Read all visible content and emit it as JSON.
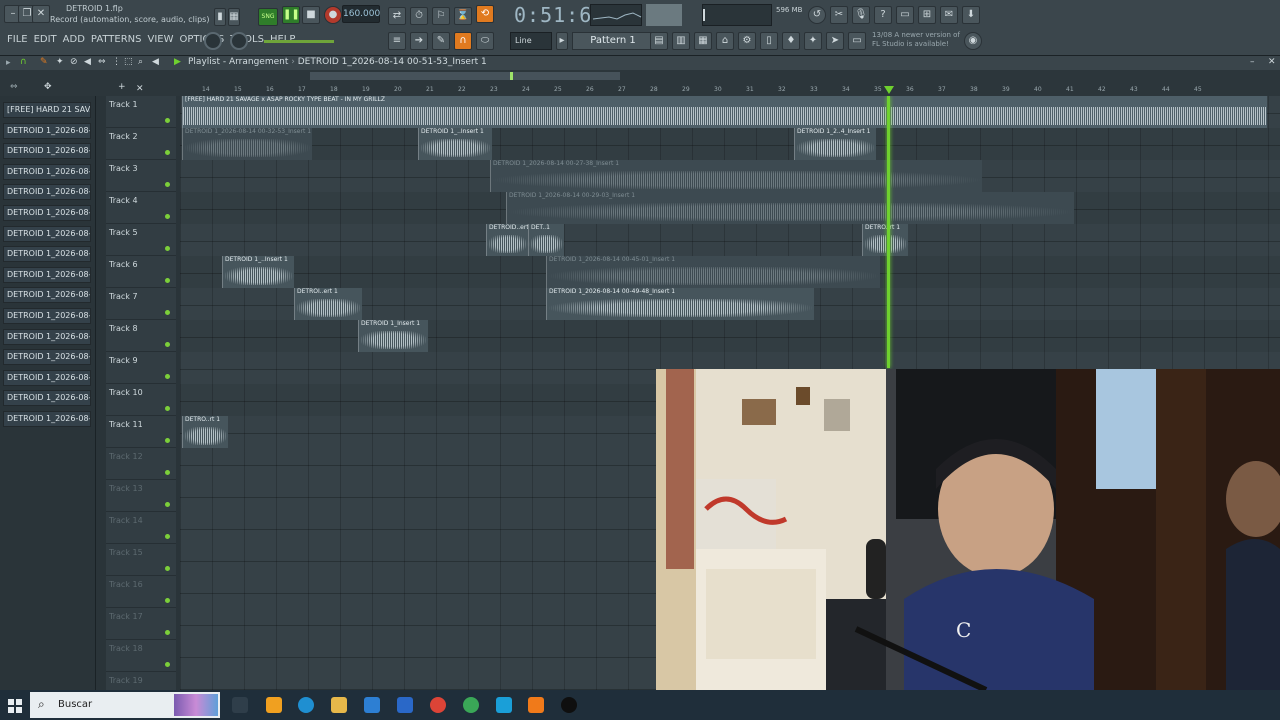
{
  "window": {
    "project_title": "DETROID 1.flp",
    "hint_text": "Record (automation, score, audio, clips)",
    "time_display": "0:51:62",
    "tempo": "160.000",
    "memory": "596 MB",
    "snap_label": "Line",
    "pattern_label": "Pattern 1",
    "news_date": "13/08",
    "news_text": "A newer version of FL Studio is available!"
  },
  "menu": [
    "FILE",
    "EDIT",
    "ADD",
    "PATTERNS",
    "VIEW",
    "OPTIONS",
    "TOOLS",
    "HELP"
  ],
  "playlist": {
    "title": "Playlist - Arrangement",
    "breadcrumb": "DETROID 1_2026-08-14 00-51-53_Insert 1",
    "ruler": [
      "14",
      "15",
      "16",
      "17",
      "18",
      "19",
      "20",
      "21",
      "22",
      "23",
      "24",
      "25",
      "26",
      "27",
      "28",
      "29",
      "30",
      "31",
      "32",
      "33",
      "34",
      "35",
      "36",
      "37",
      "38",
      "39",
      "40",
      "41",
      "42",
      "43",
      "44",
      "45"
    ]
  },
  "picker": [
    "[FREE] HARD 21 SAVA..",
    "DETROID 1_2026-08-14 0..",
    "DETROID 1_2026-08-14 0..",
    "DETROID 1_2026-08-14 0..",
    "DETROID 1_2026-08-14 0..",
    "DETROID 1_2026-08-14 0..",
    "DETROID 1_2026-08-14 0..",
    "DETROID 1_2026-08-14 0..",
    "DETROID 1_2026-08-14 0..",
    "DETROID 1_2026-08-14 0..",
    "DETROID 1_2026-08-14 0..",
    "DETROID 1_2026-08-14 0..",
    "DETROID 1_2026-08-14 0..",
    "DETROID 1_2026-08-14 0..",
    "DETROID 1_2026-08-14 0..",
    "DETROID 1_2026-08-14 0.."
  ],
  "tracks": [
    "Track 1",
    "Track 2",
    "Track 3",
    "Track 4",
    "Track 5",
    "Track 6",
    "Track 7",
    "Track 8",
    "Track 9",
    "Track 10",
    "Track 11",
    "Track 12",
    "Track 13",
    "Track 14",
    "Track 15",
    "Track 16",
    "Track 17",
    "Track 18",
    "Track 19"
  ],
  "clips": [
    {
      "label": "[FREE] HARD 21 SAVAGE x ASAP ROCKY TYPE BEAT - IN MY GRILLZ"
    },
    {
      "label": "DETROID 1_2026-08-14 00-32-53_Insert 1"
    },
    {
      "label": "DETROID 1_..Insert 1"
    },
    {
      "label": "DETROID 1_2..4_Insert 1"
    },
    {
      "label": "DETROID 1_2026-08-14 00-27-38_Insert 1"
    },
    {
      "label": "DETROID 1_2026-08-14 00-29-03_Insert 1"
    },
    {
      "label": "DETROID..ert 1"
    },
    {
      "label": "DET..1"
    },
    {
      "label": "DETRO..rt 1"
    },
    {
      "label": "DETROID 1_..Insert 1"
    },
    {
      "label": "DETROID 1_2026-08-14 00-45-01_Insert 1"
    },
    {
      "label": "DETROI..ert 1"
    },
    {
      "label": "DETROID 1_2026-08-14 00-49-48_Insert 1"
    },
    {
      "label": "DETROID 1_Insert 1"
    },
    {
      "label": "DETRO..rt 1"
    }
  ],
  "taskbar": {
    "search_placeholder": "Buscar"
  },
  "colors": {
    "accent_orange": "#e07a1f",
    "playhead_green": "#6fd12f",
    "panel_bg": "#2a3439"
  }
}
